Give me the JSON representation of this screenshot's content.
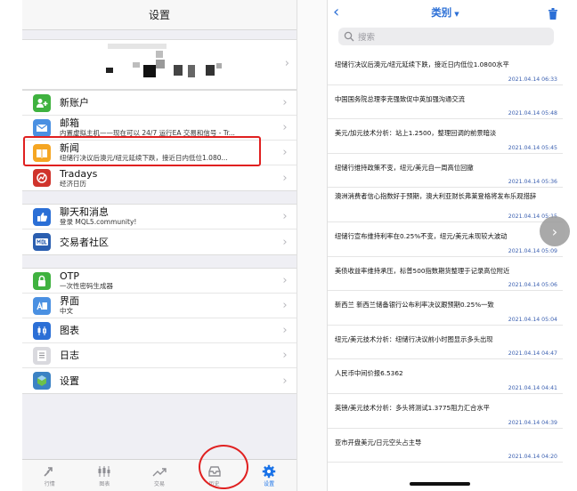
{
  "left": {
    "title": "设置",
    "menu": [
      {
        "label": "新账户",
        "sub": "",
        "icon": "add-account-icon",
        "color": "#3fb23f"
      },
      {
        "label": "邮箱",
        "sub": "内置虚拟主机——现在可以 24/7 运行EA 交易和信号 - Tr...",
        "icon": "mail-icon",
        "color": "#4a90e2"
      },
      {
        "label": "新闻",
        "sub": "纽储行决议后澳元/纽元延续下跌，接近日内低位1.080...",
        "icon": "news-book-icon",
        "color": "#f5a623"
      },
      {
        "label": "Tradays",
        "sub": "经济日历",
        "icon": "tradays-icon",
        "color": "#d0342c"
      },
      {
        "label": "聊天和消息",
        "sub": "登录 MQL5.community!",
        "icon": "chat-thumb-icon",
        "color": "#2b6fd6"
      },
      {
        "label": "交易者社区",
        "sub": "",
        "icon": "mql-community-icon",
        "color": "#2b5fb0"
      },
      {
        "label": "OTP",
        "sub": "一次性密码生成器",
        "icon": "otp-lock-icon",
        "color": "#3fb23f"
      },
      {
        "label": "界面",
        "sub": "中文",
        "icon": "language-icon",
        "color": "#4a90e2"
      },
      {
        "label": "图表",
        "sub": "",
        "icon": "chart-candle-icon",
        "color": "#2b6fd6"
      },
      {
        "label": "日志",
        "sub": "",
        "icon": "log-icon",
        "color": "#8e8e93"
      },
      {
        "label": "设置",
        "sub": "",
        "icon": "settings-app-icon",
        "color": "#3b82c4"
      }
    ],
    "tabs": [
      {
        "label": "行情",
        "icon": "quotes-icon"
      },
      {
        "label": "图表",
        "icon": "charts-icon"
      },
      {
        "label": "交易",
        "icon": "trade-icon"
      },
      {
        "label": "历史",
        "icon": "history-icon"
      },
      {
        "label": "设置",
        "icon": "gear-icon"
      }
    ]
  },
  "right": {
    "title": "类别",
    "search_placeholder": "搜索",
    "news": [
      {
        "text": "纽储行决议后澳元/纽元延续下跌，接近日内低位1.0800水平",
        "date": "2021.04.14 06:33"
      },
      {
        "text": "中国国务院总理李克强致促中英加强沟通交流",
        "date": "2021.04.14 05:48"
      },
      {
        "text": "美元/加元技术分析：站上1.2500，整理回调的前景暗淡",
        "date": "2021.04.14 05:45"
      },
      {
        "text": "纽储行维持政策不变，纽元/美元自一周高位回撤",
        "date": "2021.04.14 05:36"
      },
      {
        "text": "澳洲消费者信心指数好于预期，澳大利亚财长弗莱登格将发布乐观措辞",
        "date": "2021.04.14 05:15"
      },
      {
        "text": "纽储行宣布维持利率在0.25%不变，纽元/美元未现较大波动",
        "date": "2021.04.14 05:09"
      },
      {
        "text": "美债收益率维持承压，标普500指数期货整理于记录高位附近",
        "date": "2021.04.14 05:06"
      },
      {
        "text": "新西兰 新西兰储备银行公布利率决议跟预期0.25%一致",
        "date": "2021.04.14 05:04"
      },
      {
        "text": "纽元/美元技术分析：纽储行决议前小时图显示多头出现",
        "date": "2021.04.14 04:47"
      },
      {
        "text": "人民币中间价报6.5362",
        "date": "2021.04.14 04:41"
      },
      {
        "text": "英镑/美元技术分析：多头将测试1.3775阻力汇合水平",
        "date": "2021.04.14 04:39"
      },
      {
        "text": "亚市开盘美元/日元空头占主导",
        "date": "2021.04.14 04:20"
      }
    ]
  }
}
